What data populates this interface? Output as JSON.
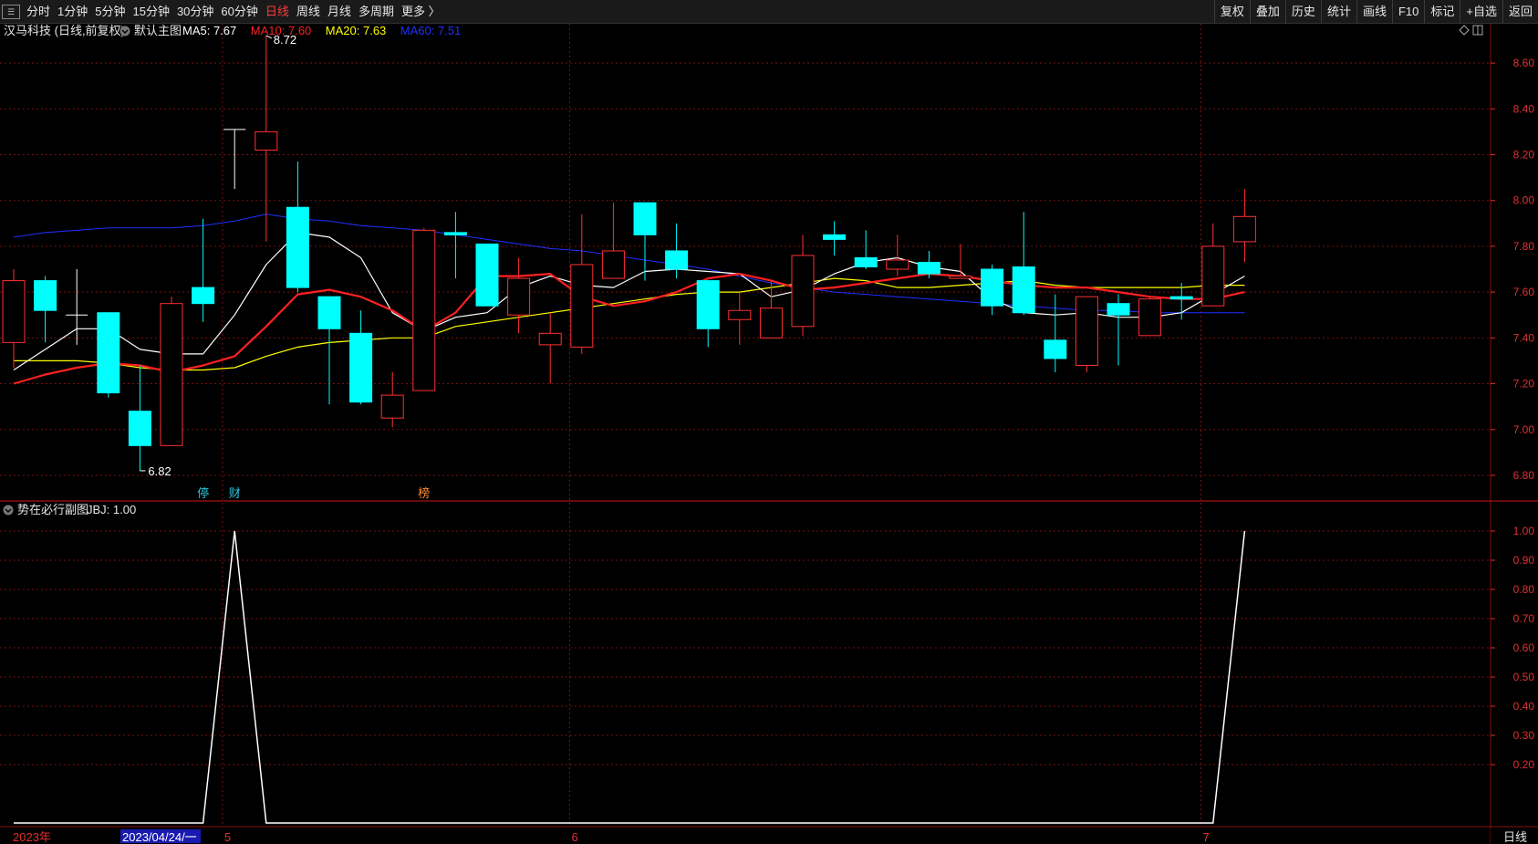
{
  "toolbar": {
    "menu_icon": "menu-icon",
    "periods": [
      {
        "label": "分时",
        "active": false
      },
      {
        "label": "1分钟",
        "active": false
      },
      {
        "label": "5分钟",
        "active": false
      },
      {
        "label": "15分钟",
        "active": false
      },
      {
        "label": "30分钟",
        "active": false
      },
      {
        "label": "60分钟",
        "active": false
      },
      {
        "label": "日线",
        "active": true
      },
      {
        "label": "周线",
        "active": false
      },
      {
        "label": "月线",
        "active": false
      },
      {
        "label": "多周期",
        "active": false
      },
      {
        "label": "更多 〉",
        "active": false
      }
    ],
    "tools": [
      "复权",
      "叠加",
      "历史",
      "统计",
      "画线",
      "F10",
      "标记",
      "+自选",
      "返回"
    ]
  },
  "main_panel": {
    "title": "汉马科技 (日线,前复权)",
    "template": "默认主图",
    "ma_labels": [
      {
        "text": "MA5: 7.67",
        "color": "#ffffff"
      },
      {
        "text": "MA10: 7.60",
        "color": "#ff2020"
      },
      {
        "text": "MA20: 7.63",
        "color": "#ffff00"
      },
      {
        "text": "MA60: 7.51",
        "color": "#2030ff"
      }
    ],
    "high_label": "8.72",
    "low_label": "6.82",
    "event_markers": [
      {
        "text": "停",
        "index": 6,
        "color": "#29c9e0"
      },
      {
        "text": "财",
        "index": 7,
        "color": "#29c9e0"
      },
      {
        "text": "榜",
        "index": 13,
        "color": "#ff8a30"
      }
    ],
    "y_ticks": [
      "8.60",
      "8.40",
      "8.20",
      "8.00",
      "7.80",
      "7.60",
      "7.40",
      "7.20",
      "7.00",
      "6.80"
    ]
  },
  "sub_panel": {
    "title": "势在必行副图",
    "value_label": "JBJ: 1.00",
    "y_ticks": [
      "1.00",
      "0.90",
      "0.80",
      "0.70",
      "0.60",
      "0.50",
      "0.40",
      "0.30",
      "0.20"
    ]
  },
  "footer": {
    "year_label": "2023年",
    "cursor_date": "2023/04/24/一",
    "month_labels": [
      {
        "text": "5",
        "index": 7
      },
      {
        "text": "6",
        "index": 18
      },
      {
        "text": "7",
        "index": 38
      }
    ],
    "period_label": "日线"
  },
  "colors": {
    "up": "#ff3030",
    "down": "#00ffff",
    "ma5": "#ffffff",
    "ma10": "#ff2020",
    "ma20": "#ffff00",
    "ma60": "#2030ff",
    "axis": "#e03030",
    "grid": "#7a1010"
  },
  "chart_data": {
    "type": "candlestick",
    "candles": [
      {
        "open": 7.38,
        "high": 7.7,
        "low": 7.27,
        "close": 7.65
      },
      {
        "open": 7.65,
        "high": 7.67,
        "low": 7.38,
        "close": 7.52
      },
      {
        "open": 7.5,
        "high": 7.7,
        "low": 7.37,
        "close": 7.5
      },
      {
        "open": 7.51,
        "high": 7.51,
        "low": 7.14,
        "close": 7.16
      },
      {
        "open": 7.08,
        "high": 7.28,
        "low": 6.82,
        "close": 6.93
      },
      {
        "open": 6.93,
        "high": 7.58,
        "low": 6.93,
        "close": 7.55
      },
      {
        "open": 7.62,
        "high": 7.92,
        "low": 7.47,
        "close": 7.55
      },
      {
        "open": 8.31,
        "high": 8.31,
        "low": 8.05,
        "close": 8.31
      },
      {
        "open": 8.22,
        "high": 8.72,
        "low": 7.82,
        "close": 8.3
      },
      {
        "open": 7.97,
        "high": 8.17,
        "low": 7.6,
        "close": 7.62
      },
      {
        "open": 7.58,
        "high": 7.58,
        "low": 7.11,
        "close": 7.44
      },
      {
        "open": 7.42,
        "high": 7.52,
        "low": 7.11,
        "close": 7.12
      },
      {
        "open": 7.05,
        "high": 7.25,
        "low": 7.01,
        "close": 7.15
      },
      {
        "open": 7.17,
        "high": 7.88,
        "low": 7.17,
        "close": 7.87
      },
      {
        "open": 7.86,
        "high": 7.95,
        "low": 7.66,
        "close": 7.85
      },
      {
        "open": 7.81,
        "high": 7.81,
        "low": 7.54,
        "close": 7.54
      },
      {
        "open": 7.5,
        "high": 7.75,
        "low": 7.42,
        "close": 7.66
      },
      {
        "open": 7.37,
        "high": 7.51,
        "low": 7.2,
        "close": 7.42
      },
      {
        "open": 7.36,
        "high": 7.94,
        "low": 7.33,
        "close": 7.72
      },
      {
        "open": 7.66,
        "high": 7.99,
        "low": 7.66,
        "close": 7.78
      },
      {
        "open": 7.99,
        "high": 7.99,
        "low": 7.65,
        "close": 7.85
      },
      {
        "open": 7.78,
        "high": 7.9,
        "low": 7.66,
        "close": 7.7
      },
      {
        "open": 7.65,
        "high": 7.65,
        "low": 7.36,
        "close": 7.44
      },
      {
        "open": 7.48,
        "high": 7.6,
        "low": 7.37,
        "close": 7.52
      },
      {
        "open": 7.4,
        "high": 7.65,
        "low": 7.4,
        "close": 7.53
      },
      {
        "open": 7.45,
        "high": 7.85,
        "low": 7.41,
        "close": 7.76
      },
      {
        "open": 7.85,
        "high": 7.91,
        "low": 7.76,
        "close": 7.83
      },
      {
        "open": 7.75,
        "high": 7.87,
        "low": 7.7,
        "close": 7.71
      },
      {
        "open": 7.7,
        "high": 7.85,
        "low": 7.67,
        "close": 7.74
      },
      {
        "open": 7.73,
        "high": 7.78,
        "low": 7.66,
        "close": 7.68
      },
      {
        "open": 7.66,
        "high": 7.81,
        "low": 7.66,
        "close": 7.67
      },
      {
        "open": 7.7,
        "high": 7.72,
        "low": 7.5,
        "close": 7.54
      },
      {
        "open": 7.71,
        "high": 7.95,
        "low": 7.5,
        "close": 7.51
      },
      {
        "open": 7.39,
        "high": 7.59,
        "low": 7.25,
        "close": 7.31
      },
      {
        "open": 7.28,
        "high": 7.58,
        "low": 7.25,
        "close": 7.58
      },
      {
        "open": 7.55,
        "high": 7.59,
        "low": 7.28,
        "close": 7.5
      },
      {
        "open": 7.41,
        "high": 7.58,
        "low": 7.41,
        "close": 7.57
      },
      {
        "open": 7.58,
        "high": 7.64,
        "low": 7.48,
        "close": 7.57
      },
      {
        "open": 7.54,
        "high": 7.9,
        "low": 7.54,
        "close": 7.8
      },
      {
        "open": 7.82,
        "high": 8.05,
        "low": 7.73,
        "close": 7.93
      }
    ],
    "ma5": [
      7.26,
      7.35,
      7.44,
      7.44,
      7.35,
      7.33,
      7.33,
      7.5,
      7.72,
      7.86,
      7.84,
      7.75,
      7.51,
      7.43,
      7.49,
      7.51,
      7.62,
      7.67,
      7.63,
      7.62,
      7.69,
      7.7,
      7.69,
      7.68,
      7.58,
      7.61,
      7.68,
      7.73,
      7.75,
      7.71,
      7.69,
      7.57,
      7.51,
      7.5,
      7.51,
      7.49,
      7.49,
      7.51,
      7.59,
      7.67
    ],
    "ma10": [
      7.2,
      7.24,
      7.27,
      7.29,
      7.28,
      7.25,
      7.28,
      7.32,
      7.45,
      7.59,
      7.61,
      7.58,
      7.52,
      7.43,
      7.51,
      7.67,
      7.67,
      7.68,
      7.58,
      7.54,
      7.56,
      7.6,
      7.66,
      7.68,
      7.65,
      7.61,
      7.62,
      7.64,
      7.66,
      7.68,
      7.67,
      7.65,
      7.63,
      7.62,
      7.62,
      7.6,
      7.58,
      7.57,
      7.57,
      7.6
    ],
    "ma20": [
      7.3,
      7.3,
      7.3,
      7.29,
      7.27,
      7.26,
      7.26,
      7.27,
      7.32,
      7.36,
      7.38,
      7.39,
      7.4,
      7.4,
      7.45,
      7.47,
      7.49,
      7.51,
      7.53,
      7.55,
      7.57,
      7.59,
      7.6,
      7.6,
      7.62,
      7.64,
      7.66,
      7.65,
      7.62,
      7.62,
      7.63,
      7.64,
      7.65,
      7.63,
      7.62,
      7.62,
      7.62,
      7.62,
      7.63,
      7.63
    ],
    "ma60": [
      7.84,
      7.86,
      7.87,
      7.88,
      7.88,
      7.88,
      7.89,
      7.91,
      7.94,
      7.92,
      7.91,
      7.89,
      7.88,
      7.87,
      7.85,
      7.83,
      7.81,
      7.79,
      7.78,
      7.76,
      7.74,
      7.72,
      7.7,
      7.67,
      7.64,
      7.62,
      7.6,
      7.59,
      7.58,
      7.57,
      7.56,
      7.55,
      7.54,
      7.53,
      7.52,
      7.52,
      7.51,
      7.51,
      7.51,
      7.51
    ],
    "jbj": [
      0,
      0,
      0,
      0,
      0,
      0,
      0,
      1,
      0,
      0,
      0,
      0,
      0,
      0,
      0,
      0,
      0,
      0,
      0,
      0,
      0,
      0,
      0,
      0,
      0,
      0,
      0,
      0,
      0,
      0,
      0,
      0,
      0,
      0,
      0,
      0,
      0,
      0,
      0,
      1
    ],
    "main_ylim": [
      6.76,
      8.7
    ],
    "sub_ylim": [
      0,
      1.05
    ]
  }
}
